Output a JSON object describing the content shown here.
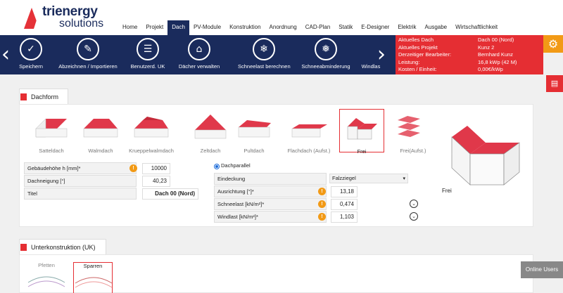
{
  "brand": {
    "name": "trienergy",
    "sub": "solutions"
  },
  "nav": [
    "Home",
    "Projekt",
    "Dach",
    "PV-Module",
    "Konstruktion",
    "Anordnung",
    "CAD-Plan",
    "Statik",
    "E-Designer",
    "Elektrik",
    "Ausgabe",
    "Wirtschaftlichkeit"
  ],
  "nav_active": "Dach",
  "toolbar": {
    "items": [
      {
        "label": "Speichern",
        "icon": "check-icon"
      },
      {
        "label": "Abzeichnen / Importieren",
        "icon": "draw-icon"
      },
      {
        "label": "Benutzerd. UK",
        "icon": "list-icon"
      },
      {
        "label": "Dächer verwalten",
        "icon": "gear-roof-icon"
      },
      {
        "label": "Schneelast berechnen",
        "icon": "snowflake-icon"
      },
      {
        "label": "Schneeabminderung",
        "icon": "snowflake-gear-icon"
      },
      {
        "label": "Windlas",
        "icon": "wind-icon"
      }
    ]
  },
  "info": [
    {
      "key": "Aktuelles Dach",
      "value": "Dach 00 (Nord)"
    },
    {
      "key": "Aktuelles Projekt",
      "value": "Kunz 2"
    },
    {
      "key": "Derzeitiger Bearbeiter:",
      "value": "Bernhard Kunz"
    },
    {
      "key": "Leistung:",
      "value": "16,8 kWp (42 M)"
    },
    {
      "key": "Kosten / Einheit:",
      "value": "0,00€/kWp"
    }
  ],
  "dachform": {
    "title": "Dachform",
    "roofs": [
      {
        "label": "Satteldach"
      },
      {
        "label": "Walmdach"
      },
      {
        "label": "Krueppelwalmdach"
      },
      {
        "label": "Zeltdach"
      },
      {
        "label": "Pultdach"
      },
      {
        "label": "Flachdach (Aufst.)"
      },
      {
        "label": "Frei"
      },
      {
        "label": "Frei(Aufst.)"
      }
    ],
    "selected": "Frei",
    "preview_label": "Frei"
  },
  "form": {
    "gebaeudehoehe_label": "Gebäudehöhe h [mm]*",
    "gebaeudehoehe_value": "10000",
    "dachneigung_label": "Dachneigung [°]",
    "dachneigung_value": "40,23",
    "titel_label": "Titel",
    "titel_value": "Dach 00 (Nord)",
    "dachparallel_label": "Dachparallel",
    "eindeckung_label": "Eindeckung",
    "eindeckung_value": "Falzziegel",
    "ausrichtung_label": "Ausrichtung [°]*",
    "ausrichtung_value": "13,18",
    "schneelast_label": "Schneelast [kN/m²]*",
    "schneelast_value": "0,474",
    "windlast_label": "Windlast [kN/m²]*",
    "windlast_value": "1,103"
  },
  "uk": {
    "title": "Unterkonstruktion (UK)",
    "tabs": [
      "Pfetten",
      "Sparren"
    ],
    "selected": "Sparren"
  },
  "online_users": "Online Users",
  "colors": {
    "navy": "#1a2b5c",
    "red": "#e52e33",
    "orange": "#f29a16"
  }
}
